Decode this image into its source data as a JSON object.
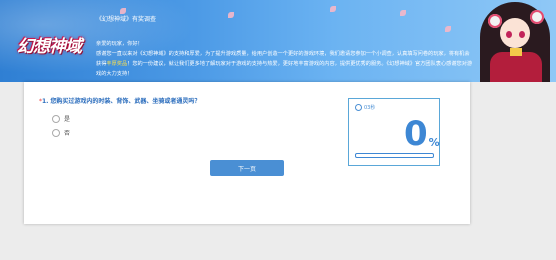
{
  "banner": {
    "logo_text": "幻想神域",
    "title": "《幻想神域》有奖调查",
    "greeting": "亲爱的玩家，你好！",
    "body_part1": "感谢您一直以来对《幻想神域》的支持和厚爱，为了提升游戏质量，给用户创造一个更好的游戏环境，我们邀请您参加一个小调查，认真填写问卷的玩家，将有机会获得",
    "body_highlight": "丰厚奖品",
    "body_part2": "！您的一份建议，就让我们更多地了解玩家对于游戏的支持与热爱，更好地丰富游戏的内容，提供更优秀的服务。《幻想神域》官方团队衷心感谢您对游戏的大力支持！"
  },
  "question": {
    "required_mark": "*",
    "number": "1.",
    "text": "您购买过游戏内的时装、背饰、武器、坐骑或者通灵吗？",
    "options": [
      {
        "label": "是"
      },
      {
        "label": "否"
      }
    ]
  },
  "next_button_label": "下一页",
  "progress": {
    "timer_label": "03秒",
    "percent_digit": "0",
    "percent_sign": "%",
    "value": 0
  },
  "colors": {
    "accent": "#3d87d4",
    "button": "#4a8fd4",
    "highlight": "#ffe14a"
  }
}
